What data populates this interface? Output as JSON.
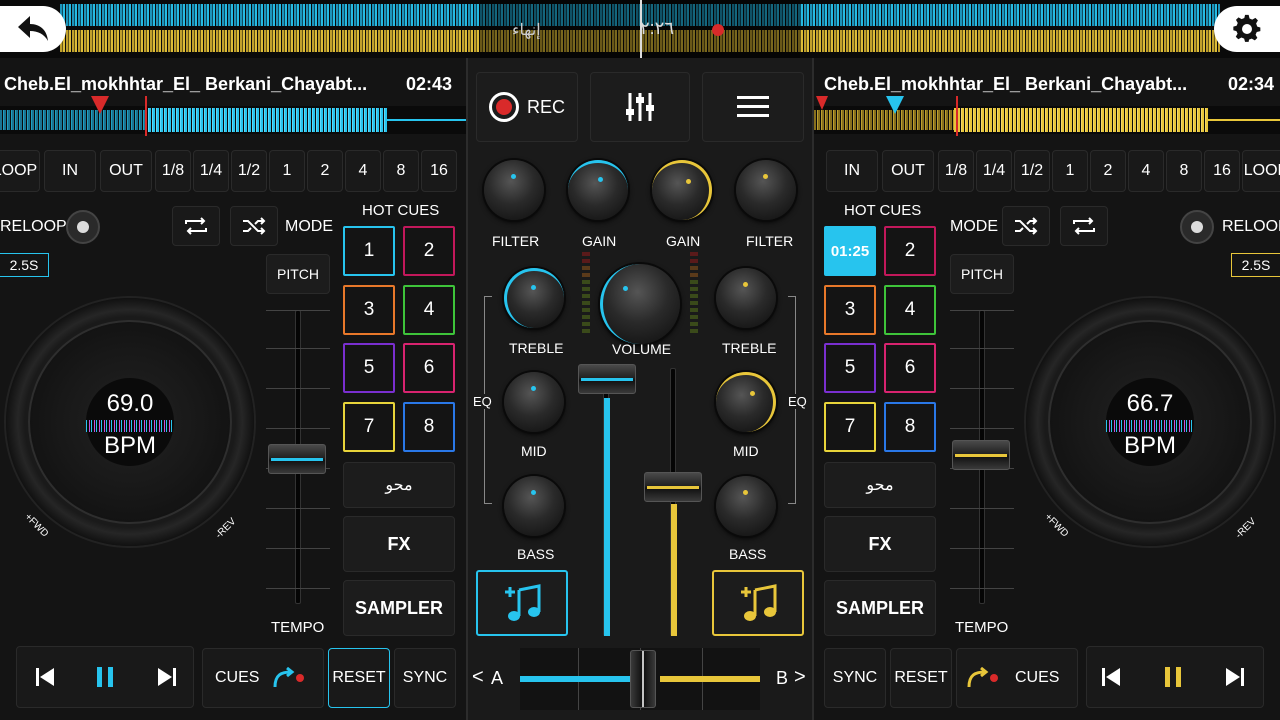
{
  "top": {
    "back_icon": "back-arrow-icon",
    "settings_icon": "gear-icon",
    "end_label": "إنهاء",
    "time_label": "٢:٢٦"
  },
  "deck_a": {
    "track_title": "Cheb.El_mokhhtar_El_ Berkani_Chayabt...",
    "time": "02:43",
    "loop_row": [
      "LOOP",
      "IN",
      "OUT",
      "1/8",
      "1/4",
      "1/2",
      "1",
      "2",
      "4",
      "8",
      "16"
    ],
    "reloop": "RELOOP",
    "mode": "MODE",
    "hot_cues": "HOT CUES",
    "loop_length": "2.5S",
    "pitch": "PITCH",
    "tempo": "TEMPO",
    "bpm_value": "69.0",
    "bpm_label": "BPM",
    "fwd": "+FWD",
    "rev": "-REV",
    "pads": [
      "1",
      "2",
      "3",
      "4",
      "5",
      "6",
      "7",
      "8"
    ],
    "erase": "محو",
    "fx": "FX",
    "sampler": "SAMPLER",
    "cues": "CUES",
    "reset": "RESET",
    "sync": "SYNC",
    "accent": "#27c4ee"
  },
  "deck_b": {
    "track_title": "Cheb.El_mokhhtar_El_ Berkani_Chayabt...",
    "time": "02:34",
    "loop_row": [
      "IN",
      "OUT",
      "1/8",
      "1/4",
      "1/2",
      "1",
      "2",
      "4",
      "8",
      "16",
      "LOOP"
    ],
    "reloop": "RELOOP",
    "mode": "MODE",
    "hot_cues": "HOT CUES",
    "loop_length": "2.5S",
    "pitch": "PITCH",
    "tempo": "TEMPO",
    "bpm_value": "66.7",
    "bpm_label": "BPM",
    "fwd": "+FWD",
    "rev": "-REV",
    "pads": [
      "01:25",
      "2",
      "3",
      "4",
      "5",
      "6",
      "7",
      "8"
    ],
    "erase": "محو",
    "fx": "FX",
    "sampler": "SAMPLER",
    "cues": "CUES",
    "reset": "RESET",
    "sync": "SYNC",
    "accent": "#e8c63a"
  },
  "mixer": {
    "rec": "REC",
    "filter": "FILTER",
    "gain": "GAIN",
    "treble": "TREBLE",
    "volume": "VOLUME",
    "eq": "EQ",
    "mid": "MID",
    "bass": "BASS",
    "crossfader_a": "A",
    "crossfader_b": "B",
    "prev_arrow": "<",
    "next_arrow": ">"
  },
  "colors": {
    "cyan": "#27c4ee",
    "yellow": "#e8c63a",
    "pad_cyan": "#27c4ee",
    "pad_red": "#c2185b",
    "pad_orange": "#e8782a",
    "pad_green": "#3ec43a",
    "pad_purple": "#7a2fd0",
    "pad_pink": "#d8236f",
    "pad_yellow": "#e8d43a",
    "pad_blue": "#2a78e8"
  }
}
